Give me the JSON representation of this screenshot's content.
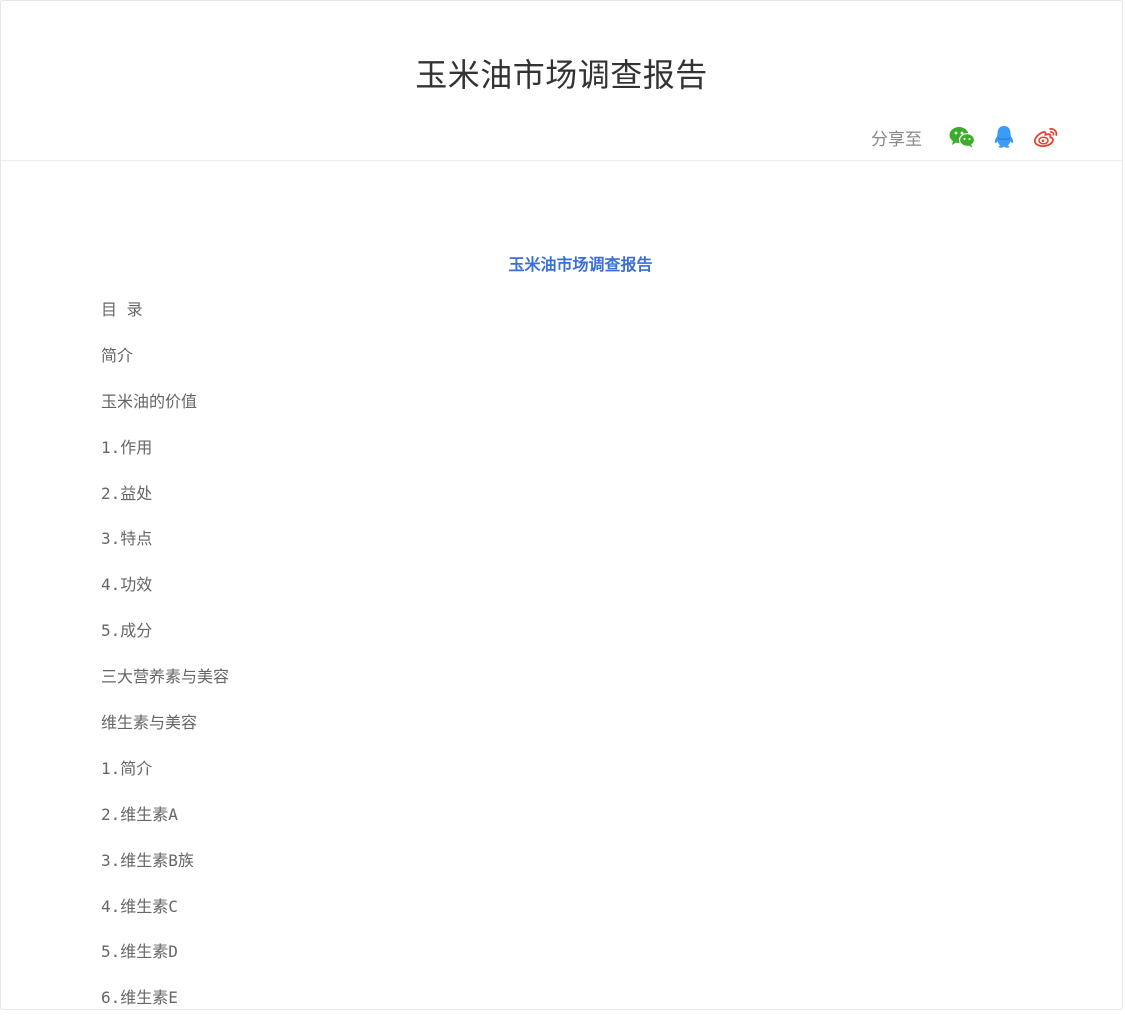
{
  "header": {
    "title": "玉米油市场调查报告",
    "share_label": "分享至",
    "share_icons": [
      {
        "name": "wechat-icon",
        "color": "#3aae2a"
      },
      {
        "name": "qq-icon",
        "color": "#3d9bf5"
      },
      {
        "name": "weibo-icon",
        "color": "#e6432e"
      }
    ]
  },
  "document": {
    "heading": "玉米油市场调查报告",
    "heading_color": "#3a6fd8",
    "toc": [
      "目 录",
      "简介",
      "玉米油的价值",
      "1.作用",
      "2.益处",
      "3.特点",
      "4.功效",
      "5.成分",
      "三大营养素与美容",
      "维生素与美容",
      "1.简介",
      "2.维生素A",
      "3.维生素B族",
      "4.维生素C",
      "5.维生素D",
      "6.维生素E"
    ]
  }
}
